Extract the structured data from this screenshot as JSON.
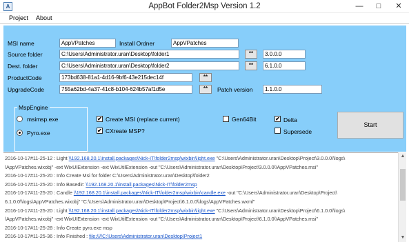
{
  "window": {
    "title": "AppBot Folder2Msp Version 1.2",
    "app_icon": "A",
    "minimize_glyph": "—",
    "maximize_glyph": "□",
    "close_glyph": "✕"
  },
  "menu": {
    "project": "Project",
    "about": "About"
  },
  "form": {
    "msi_name_label": "MSI name",
    "msi_name_value": "AppVPatches",
    "install_order_label": "Install Ordner",
    "install_order_value": "AppVPatches",
    "source_folder_label": "Source folder",
    "source_folder_value": "C:\\Users\\Administrator.uran\\Desktop\\folder1",
    "source_browse": "**",
    "source_version": "3.0.0.0",
    "dest_folder_label": "Dest. folder",
    "dest_folder_value": "C:\\Users\\Administrator.uran\\Desktop\\folder2",
    "dest_browse": "**",
    "dest_version": "6.1.0.0",
    "product_code_label": "ProductCode",
    "product_code_value": "173bd638-81a1-4d16-9bf6-43e215dec14f",
    "product_gen": "**",
    "upgrade_code_label": "UpgradeCode",
    "upgrade_code_value": "755a62bd-4a37-41c8-b104-624b57af1d5e",
    "upgrade_gen": "**",
    "patch_version_label": "Patch version",
    "patch_version_value": "1.1.0.0"
  },
  "msp_engine": {
    "title": "MspEngine",
    "option1": "msimsp.exe",
    "option2": "Pyro.exe",
    "selected": "Pyro.exe"
  },
  "options": {
    "create_msi": "Create MSI  (replace current)",
    "create_msp": "CXreate MSP?",
    "gen64bit": "Gen64Bit",
    "delta": "Delta",
    "supersede": "Supersede",
    "checked_mark": "✔"
  },
  "start_label": "Start",
  "log": [
    [
      {
        "t": "2016-10-17#11-25-12 : Light  "
      },
      {
        "t": "\\\\192.168.20.1\\install.packages\\Nick-IT\\folder2msp\\wixbin\\light.exe",
        "link": true
      },
      {
        "t": " \"C:\\Users\\Administrator.uran\\Desktop\\Project\\3.0.0.0\\\\logs\\"
      }
    ],
    [
      {
        "t": "\\AppVPatches.wixobj\" -ext WixUIExtension -ext WixUtilExtension -out \"C:\\Users\\Administrator.uran\\Desktop\\Project\\3.0.0.0\\\\AppVPatches.msi\""
      }
    ],
    [
      {
        "t": "2016-10-17#11-25-20 : Info  Create Msi for folder C:\\Users\\Administrator.uran\\Desktop\\folder2"
      }
    ],
    [
      {
        "t": "2016-10-17#11-25-20 : Info  Basedir:  "
      },
      {
        "t": "\\\\192.168.20.1\\install.packages\\Nick-IT\\folder2msp",
        "link": true
      }
    ],
    [
      {
        "t": "2016-10-17#11-25-20 : Candle  "
      },
      {
        "t": "\\\\192.168.20.1\\install.packages\\Nick-IT\\folder2msp\\wixbin\\candle.exe",
        "link": true
      },
      {
        "t": " -out \"C:\\Users\\Administrator.uran\\Desktop\\Project\\"
      }
    ],
    [
      {
        "t": "6.1.0.0\\\\logs\\AppVPatches.wixobj\" \"C:\\Users\\Administrator.uran\\Desktop\\Project\\6.1.0.0\\\\logs\\AppVPatches.wxml\""
      }
    ],
    [
      {
        "t": "2016-10-17#11-25-20 : Light  "
      },
      {
        "t": "\\\\192.168.20.1\\install.packages\\Nick-IT\\folder2msp\\wixbin\\light.exe",
        "link": true
      },
      {
        "t": " \"C:\\Users\\Administrator.uran\\Desktop\\Project\\6.1.0.0\\\\logs\\"
      }
    ],
    [
      {
        "t": "\\AppVPatches.wixobj\" -ext WixUIExtension -ext WixUtilExtension -out \"C:\\Users\\Administrator.uran\\Desktop\\Project\\6.1.0.0\\\\AppVPatches.msi\""
      }
    ],
    [
      {
        "t": "2016-10-17#11-25-28 : Info  Create pyro.exe msp"
      }
    ],
    [
      {
        "t": "2016-10-17#11-25-36 : Info  Finished : "
      },
      {
        "t": "file:////C:\\Users\\Administrator.uran\\Desktop\\Project1",
        "link": true
      }
    ]
  ],
  "scroll": {
    "up": "▲",
    "down": "▼"
  }
}
